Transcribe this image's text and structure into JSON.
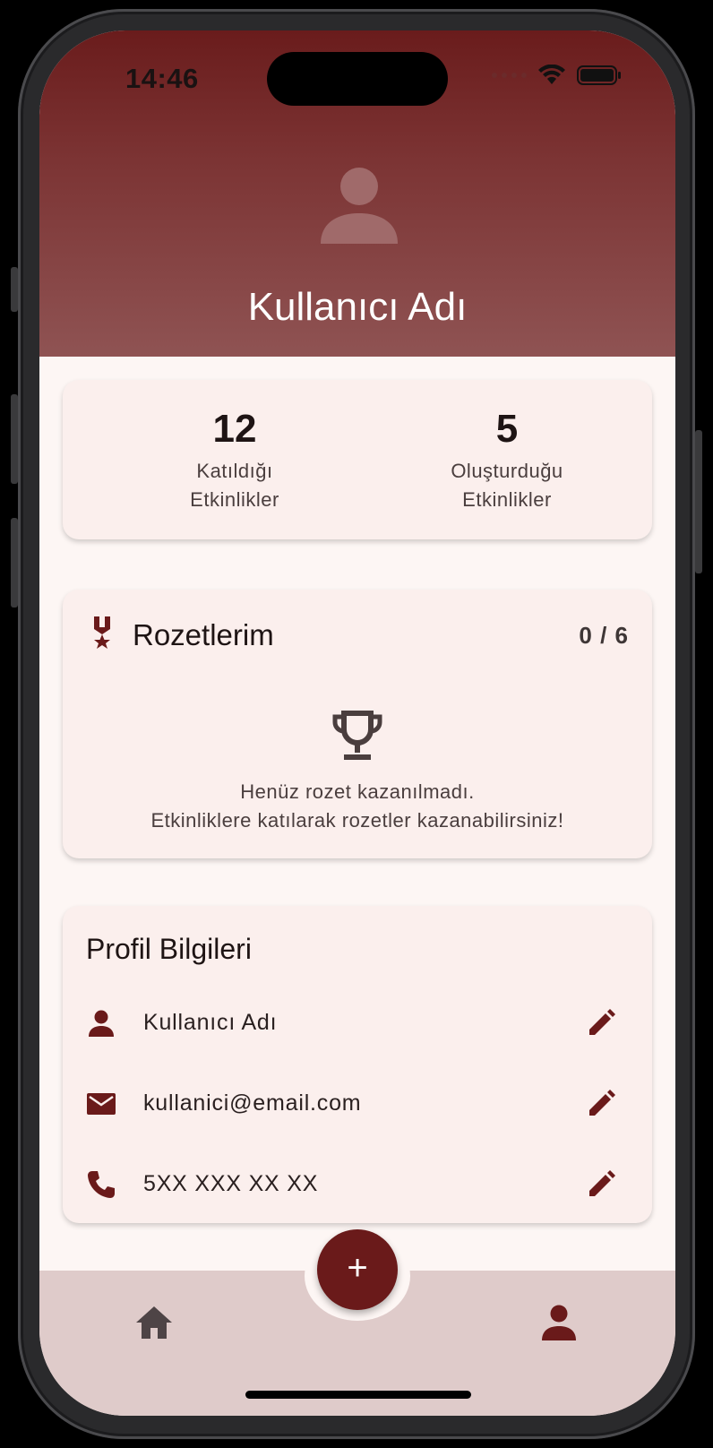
{
  "status_bar": {
    "time": "14:46"
  },
  "header": {
    "profile_name": "Kullanıcı Adı",
    "avatar_icon": "person-icon"
  },
  "stats": [
    {
      "value": "12",
      "label_line1": "Katıldığı",
      "label_line2": "Etkinlikler"
    },
    {
      "value": "5",
      "label_line1": "Oluşturduğu",
      "label_line2": "Etkinlikler"
    }
  ],
  "badges": {
    "title": "Rozetlerim",
    "count": "0 / 6",
    "icon": "medal-icon",
    "empty_icon": "trophy-icon",
    "empty_line1": "Henüz rozet kazanılmadı.",
    "empty_line2": "Etkinliklere katılarak rozetler kazanabilirsiniz!"
  },
  "profile_info": {
    "title": "Profil Bilgileri",
    "rows": [
      {
        "icon": "person-icon",
        "value": "Kullanıcı Adı"
      },
      {
        "icon": "mail-icon",
        "value": "kullanici@email.com"
      },
      {
        "icon": "phone-icon",
        "value": "5XX XXX XX XX"
      }
    ]
  },
  "bottom_nav": {
    "fab_label": "+",
    "items": [
      "home-icon",
      "profile-icon"
    ]
  },
  "colors": {
    "primary": "#6a1a1a",
    "header_top": "#6a1c1c",
    "header_bottom": "#8f5353",
    "card_bg": "#fbefed",
    "nav_bg": "#dfcbca"
  }
}
